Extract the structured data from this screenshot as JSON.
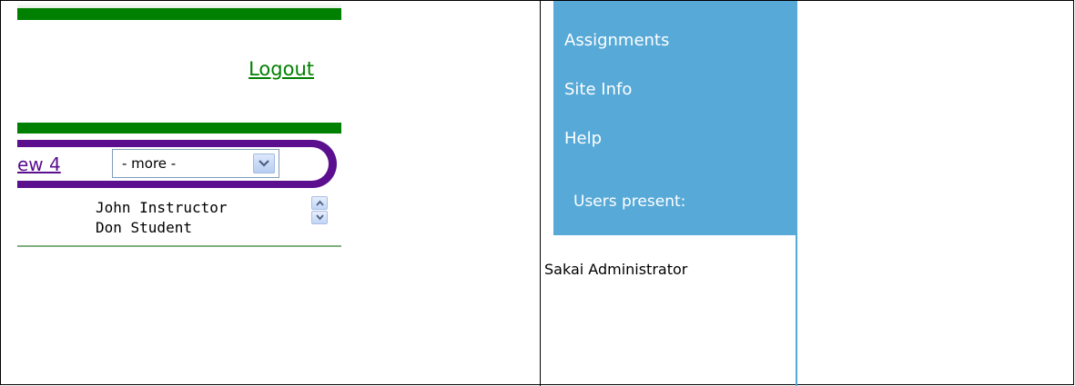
{
  "left_panel": {
    "logout_label": "Logout",
    "tab_link_label": "ew 4",
    "more_select": {
      "value": "- more -"
    },
    "presence_users": [
      "John Instructor",
      "Don Student"
    ]
  },
  "right_panel": {
    "nav_items": [
      {
        "label": "Assignments"
      },
      {
        "label": "Site Info"
      },
      {
        "label": "Help"
      }
    ],
    "users_present_label": "Users present:",
    "presence_users": [
      "Sakai Administrator"
    ]
  },
  "colors": {
    "green_bar": "#008000",
    "purple_tabbar": "#5b0f8f",
    "sidebar_blue": "#57a9d8"
  }
}
